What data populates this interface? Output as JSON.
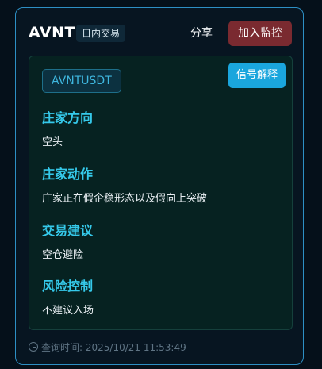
{
  "header": {
    "symbol": "AVNT",
    "tag": "日内交易",
    "share_label": "分享",
    "monitor_label": "加入监控"
  },
  "panel": {
    "pair": "AVNTUSDT",
    "explain_label": "信号解释",
    "sections": [
      {
        "title": "庄家方向",
        "text": "空头"
      },
      {
        "title": "庄家动作",
        "text": "庄家正在假企稳形态以及假向上突破"
      },
      {
        "title": "交易建议",
        "text": "空仓避险"
      },
      {
        "title": "风险控制",
        "text": "不建议入场"
      }
    ]
  },
  "footer": {
    "icon": "clock-icon",
    "query_time": "查询时间: 2025/10/21 11:53:49"
  },
  "colors": {
    "accent": "#35c9ea",
    "card_border": "#2d8fc4",
    "monitor_button": "#7a2a30",
    "explain_button": "#1aa6dd"
  }
}
